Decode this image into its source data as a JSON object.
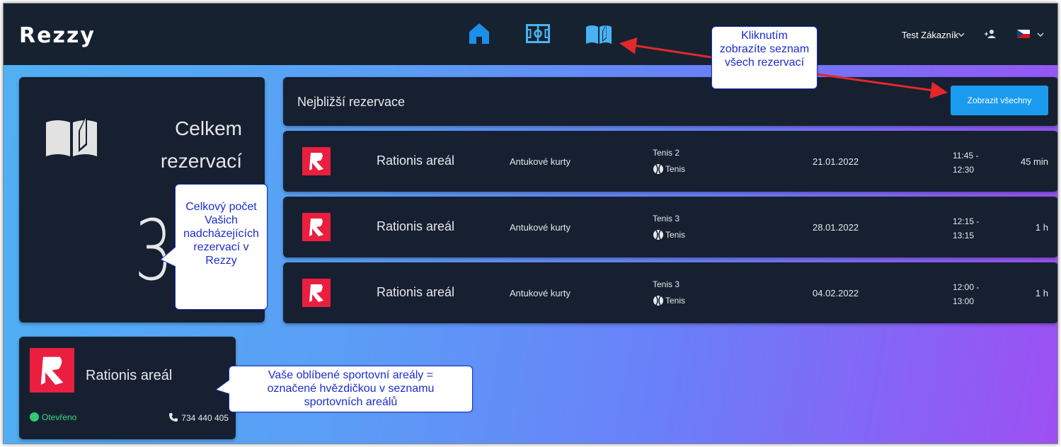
{
  "app": {
    "logo": "Rezzy"
  },
  "header": {
    "nav": [
      "home-icon",
      "stadium-icon",
      "book-icon"
    ],
    "user_name": "Test Zákazník",
    "language_flag": "flag-cz-icon"
  },
  "summary": {
    "label_line1": "Celkem",
    "label_line2": "rezervací",
    "count": "3"
  },
  "reservations": {
    "title": "Nejbližší rezervace",
    "show_all_label": "Zobrazit všechny",
    "rows": [
      {
        "venue": "Rationis areál",
        "type": "Antukové kurty",
        "court": "Tenis 2",
        "sport": "Tenis",
        "date": "21.01.2022",
        "time_start": "11:45 -",
        "time_end": "12:30",
        "duration": "45 min"
      },
      {
        "venue": "Rationis areál",
        "type": "Antukové kurty",
        "court": "Tenis 3",
        "sport": "Tenis",
        "date": "28.01.2022",
        "time_start": "12:15 -",
        "time_end": "13:15",
        "duration": "1 h"
      },
      {
        "venue": "Rationis areál",
        "type": "Antukové kurty",
        "court": "Tenis 3",
        "sport": "Tenis",
        "date": "04.02.2022",
        "time_start": "12:00 -",
        "time_end": "13:00",
        "duration": "1 h"
      }
    ]
  },
  "favorite": {
    "name": "Rationis areál",
    "status": "Otevřeno",
    "phone": "734 440 405"
  },
  "callouts": {
    "show_all_lines": [
      "Kliknutím",
      "zobrazíte seznam",
      "všech rezervací"
    ],
    "count_lines": [
      "Celkový počet",
      "Vašich",
      "nadcházejících",
      "rezervací v",
      "Rezzy"
    ],
    "favorite_lines": [
      "Vaše oblíbené sportovní areály =",
      "označené hvězdičkou v seznamu",
      "sportovních areálů"
    ]
  },
  "colors": {
    "accent": "#1a9bef",
    "brand_red": "#ea1f40",
    "card_bg": "#162030",
    "topbar_bg": "#172231",
    "open_green": "#2ecc71",
    "callout_blue": "#1b2ccf"
  }
}
